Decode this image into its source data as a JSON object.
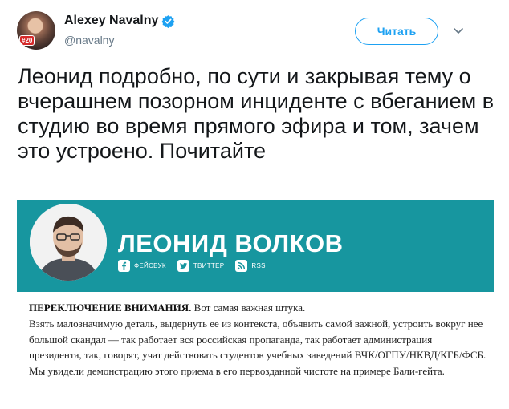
{
  "user": {
    "display_name": "Alexey Navalny",
    "handle": "@navalny",
    "avatar_badge": "#20"
  },
  "follow_button": {
    "label": "Читать"
  },
  "tweet": {
    "text": "Леонид подробно, по сути и закрывая тему о вчерашнем позорном инциденте с вбеганием в студию во время прямого эфира и том, зачем это устроено. Почитайте"
  },
  "card": {
    "title": "ЛЕОНИД ВОЛКОВ",
    "social": [
      {
        "icon": "facebook-icon",
        "label": "ФЕЙСБУК"
      },
      {
        "icon": "twitter-icon",
        "label": "ТВИТТЕР"
      },
      {
        "icon": "rss-icon",
        "label": "RSS"
      }
    ],
    "body_heading": "ПЕРЕКЛЮЧЕНИЕ ВНИМАНИЯ.",
    "body_lead": " Вот самая важная штука.",
    "body_text": "Взять малозначимую деталь, выдернуть ее из контекста, объявить самой важной, устроить вокруг нее большой скандал — так работает вся российская пропаганда, так работает администрация президента, так, говорят, учат действовать студентов учебных заведений ВЧК/ОГПУ/НКВД/КГБ/ФСБ. Мы увидели демонстрацию этого приема в его первозданной чистоте на примере Бали-гейта."
  },
  "colors": {
    "accent": "#1da1f2",
    "card_header_bg": "#17969f"
  }
}
